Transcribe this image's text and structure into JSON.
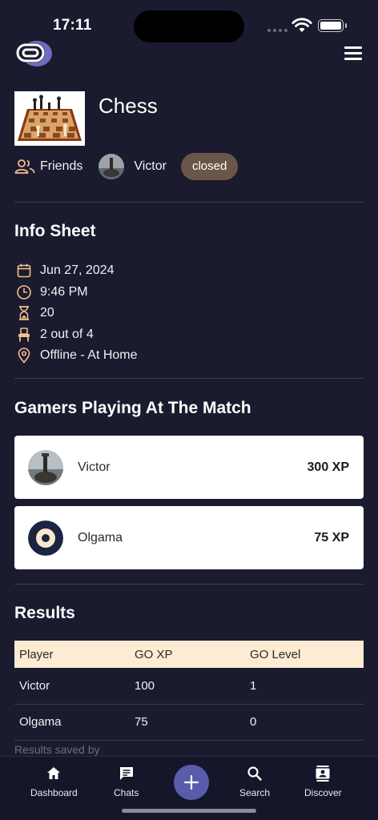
{
  "status_bar": {
    "time": "17:11"
  },
  "game": {
    "title": "Chess"
  },
  "meta": {
    "visibility": "Friends",
    "host_name": "Victor",
    "status": "closed"
  },
  "info_sheet": {
    "title": "Info Sheet",
    "items": [
      {
        "icon": "calendar-icon",
        "text": "Jun 27, 2024"
      },
      {
        "icon": "clock-icon",
        "text": "9:46 PM"
      },
      {
        "icon": "hourglass-icon",
        "text": "20"
      },
      {
        "icon": "seat-icon",
        "text": "2 out of 4"
      },
      {
        "icon": "location-pin-icon",
        "text": "Offline - At Home"
      }
    ]
  },
  "gamers": {
    "title": "Gamers Playing At The Match",
    "players": [
      {
        "name": "Victor",
        "xp": "300 XP"
      },
      {
        "name": "Olgama",
        "xp": "75 XP"
      }
    ]
  },
  "results": {
    "title": "Results",
    "columns": [
      "Player",
      "GO XP",
      "GO Level"
    ],
    "rows": [
      [
        "Victor",
        "100",
        "1"
      ],
      [
        "Olgama",
        "75",
        "0"
      ]
    ],
    "note": "Results saved by"
  },
  "nav": {
    "items": [
      {
        "label": "Dashboard",
        "icon": "home-icon"
      },
      {
        "label": "Chats",
        "icon": "chat-icon"
      },
      {
        "label": "Search",
        "icon": "search-icon"
      },
      {
        "label": "Discover",
        "icon": "contact-book-icon"
      }
    ],
    "fab_icon": "plus-icon"
  },
  "colors": {
    "background": "#1b1b2f",
    "accent": "#5b5bab",
    "badge": "#6a5649",
    "icon_accent": "#f5c08c",
    "table_header": "#fdebd3"
  }
}
